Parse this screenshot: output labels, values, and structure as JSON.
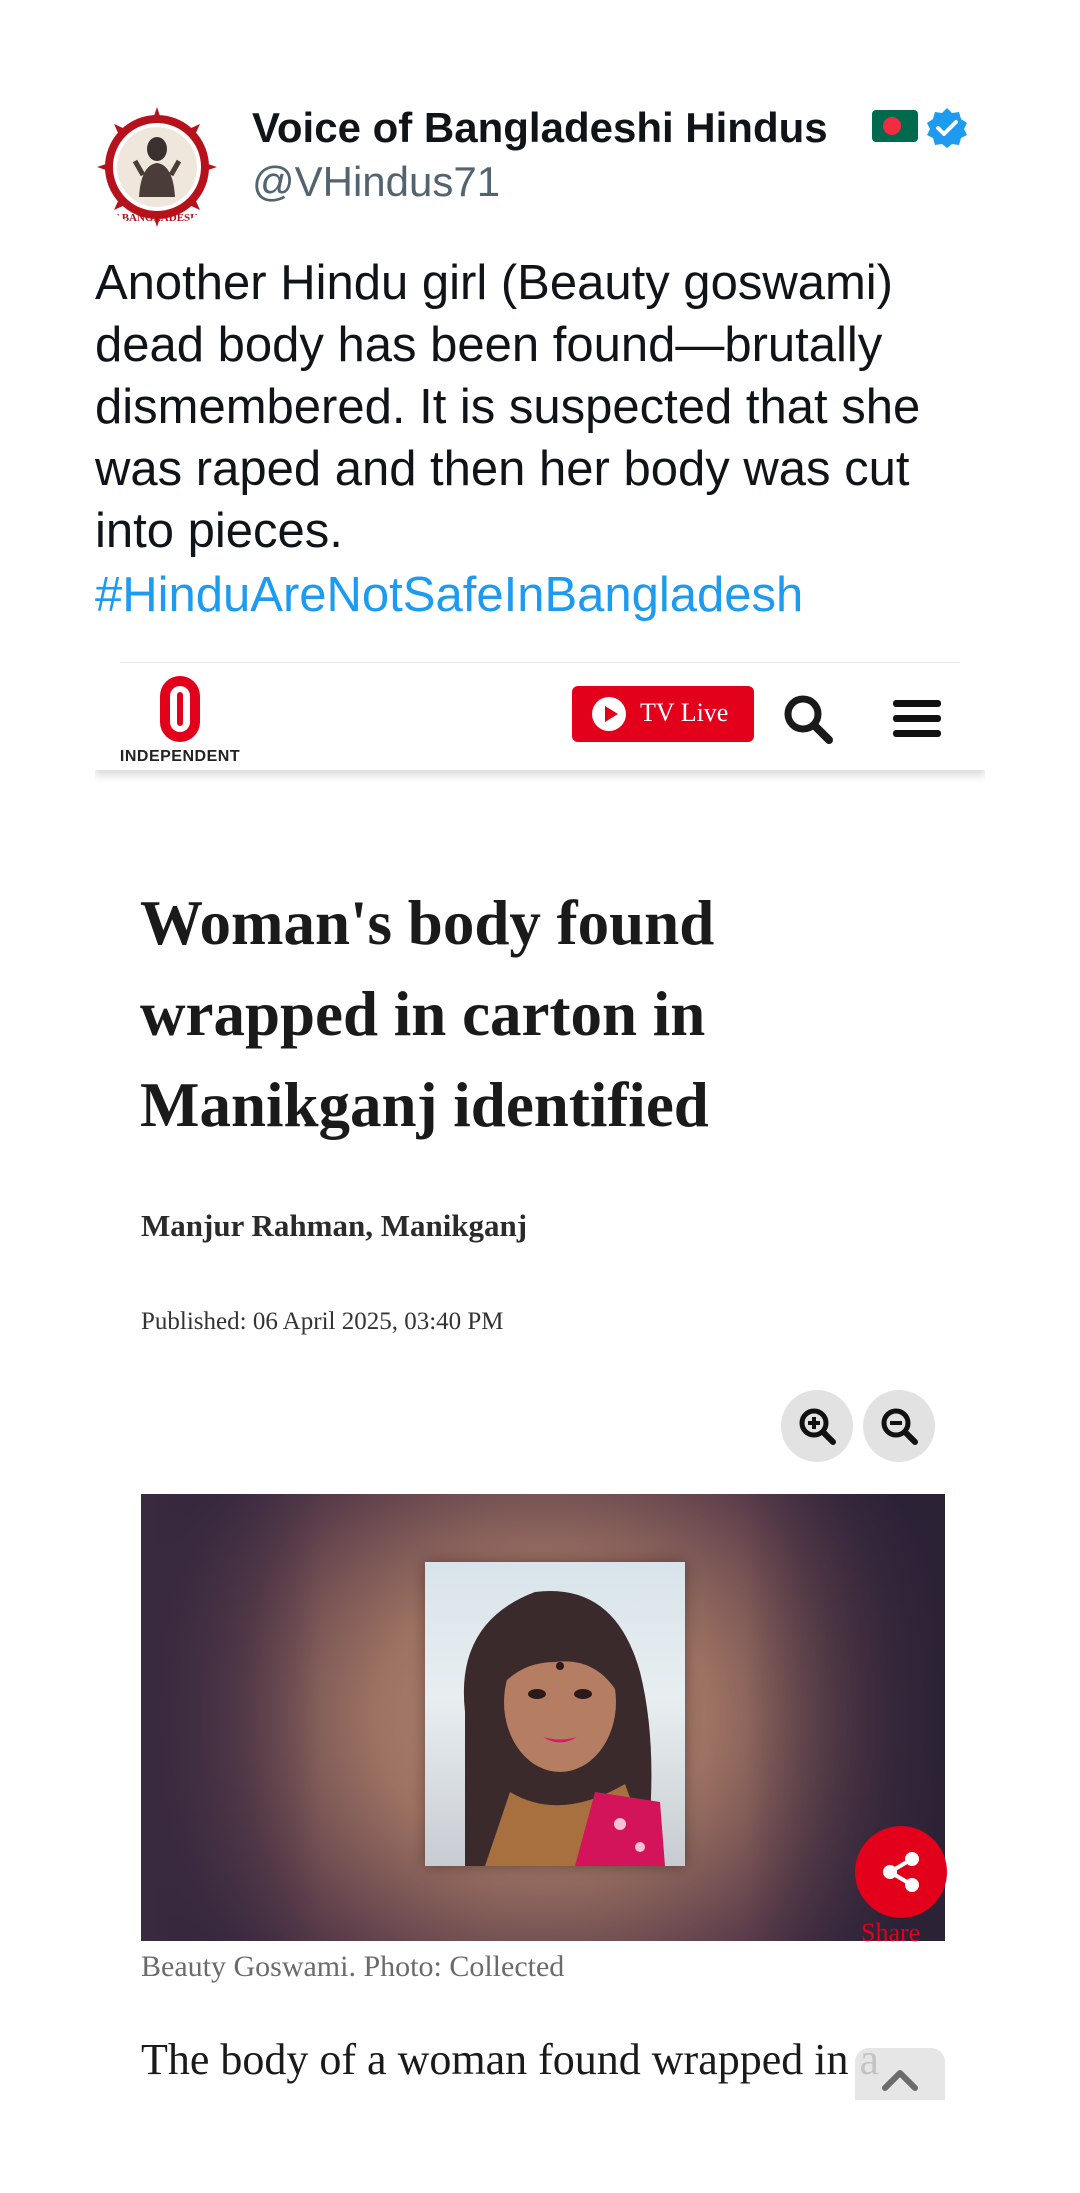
{
  "tweet": {
    "display_name": "Voice of Bangladeshi Hindus",
    "handle": "@VHindus71",
    "text_lines": [
      "Another Hindu girl  (Beauty goswami)",
      "dead body has been found—brutally",
      "dismembered. It is suspected that she",
      "was raped and then her body was cut",
      "into pieces."
    ],
    "hashtag": "#HinduAreNotSafeInBangladesh",
    "avatar_icon": "om-deity-emblem-icon",
    "avatar_ring_text": "VOICE OF BANGLADESHI HINDUS",
    "flag_icon": "bangladesh-flag-icon",
    "verified_icon": "verified-badge-icon",
    "colors": {
      "text": "#0f1419",
      "handle": "#536471",
      "hashtag": "#1d9bf0"
    }
  },
  "article": {
    "site_logo_text": "INDEPENDENT",
    "tv_live_label": "TV Live",
    "headline_lines": [
      "Woman's body found",
      "wrapped in carton in",
      "Manikganj identified"
    ],
    "byline": "Manjur Rahman, Manikganj",
    "published": "Published: 06 April 2025, 03:40 PM",
    "image_caption": "Beauty Goswami. Photo: Collected",
    "share_label": "Share",
    "body_start": "The body of a woman found wrapped in a",
    "icons": {
      "play": "play-icon",
      "search": "search-icon",
      "menu": "menu-icon",
      "zoom_in": "zoom-in-icon",
      "zoom_out": "zoom-out-icon",
      "share": "share-icon",
      "scroll_top": "chevron-up-icon"
    },
    "colors": {
      "brand_red": "#e2001a"
    }
  }
}
